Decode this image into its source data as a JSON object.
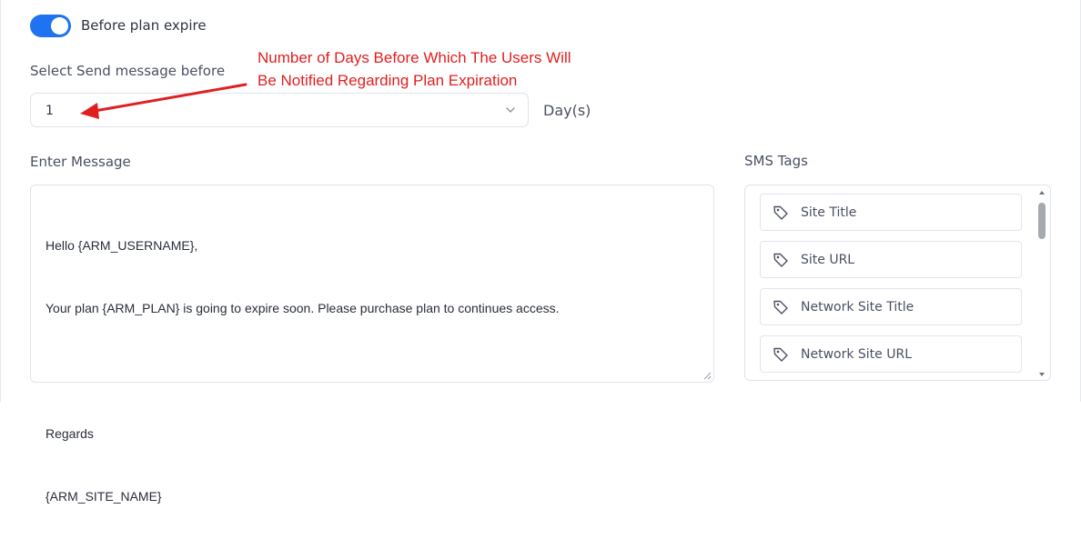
{
  "toggle": {
    "label": "Before plan expire",
    "checked": true
  },
  "send_before": {
    "label": "Select Send message before",
    "selected_value": "1",
    "unit": "Day(s)"
  },
  "annotation": {
    "line1": "Number of Days Before Which The Users Will",
    "line2": "Be Notified Regarding Plan Expiration",
    "color": "#e02020"
  },
  "message": {
    "label": "Enter Message",
    "lines": [
      "Hello {ARM_USERNAME},",
      "Your plan {ARM_PLAN} is going to expire soon. Please purchase plan to continues access.",
      "",
      "Regards",
      "{ARM_SITE_NAME}"
    ]
  },
  "sms_tags": {
    "label": "SMS Tags",
    "items": [
      {
        "label": "Site Title",
        "icon": "tag-icon"
      },
      {
        "label": "Site URL",
        "icon": "tag-icon"
      },
      {
        "label": "Network Site Title",
        "icon": "tag-icon"
      },
      {
        "label": "Network Site URL",
        "icon": "tag-icon"
      }
    ]
  },
  "colors": {
    "accent": "#1f73f0",
    "border": "#dfe3ea"
  }
}
